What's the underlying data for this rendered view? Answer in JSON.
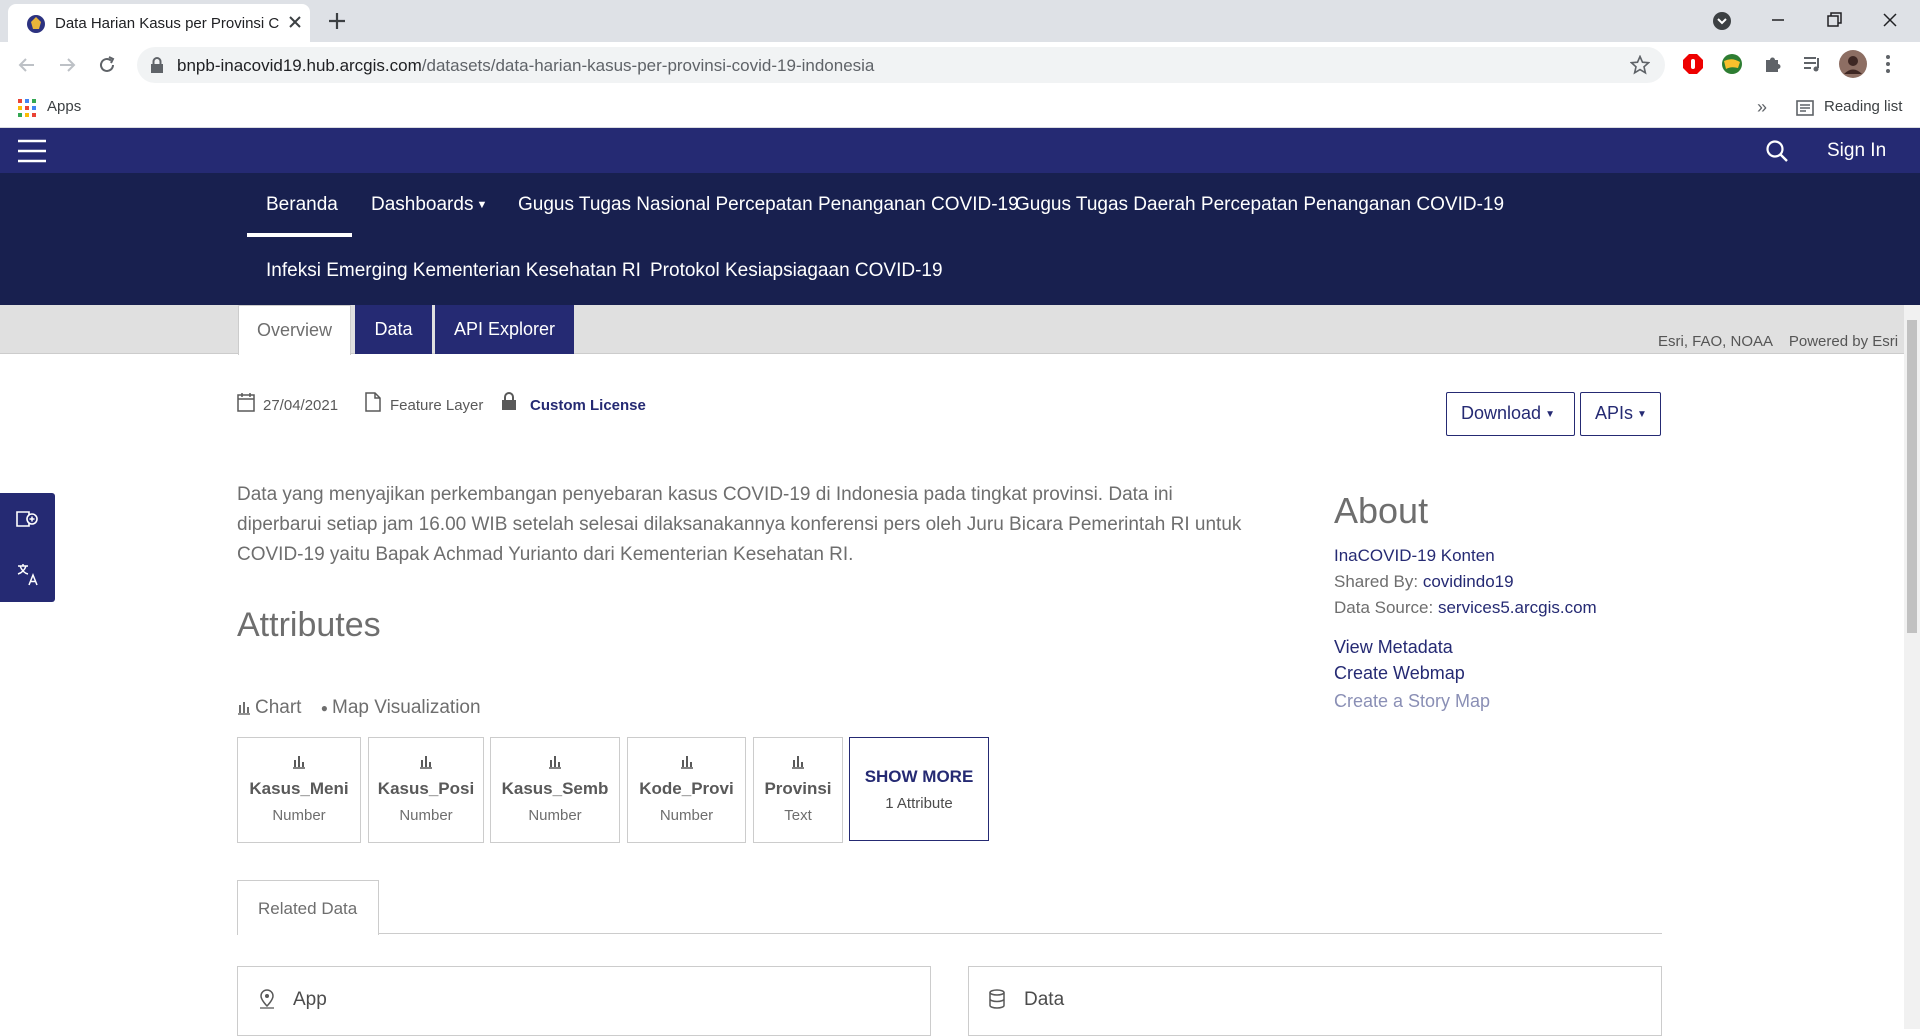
{
  "browser": {
    "tab_title": "Data Harian Kasus per Provinsi C",
    "url_host": "bnpb-inacovid19.hub.arcgis.com",
    "url_path": "/datasets/data-harian-kasus-per-provinsi-covid-19-indonesia",
    "bookmarks": {
      "apps": "Apps",
      "reading_list": "Reading list"
    }
  },
  "site": {
    "sign_in": "Sign In",
    "nav": [
      {
        "label": "Beranda"
      },
      {
        "label": "Dashboards"
      },
      {
        "label": "Gugus Tugas Nasional Percepatan Penanganan COVID-19"
      },
      {
        "label": "Gugus Tugas Daerah Percepatan Penanganan COVID-19"
      },
      {
        "label": "Infeksi Emerging Kementerian Kesehatan RI"
      },
      {
        "label": "Protokol Kesiapsiagaan COVID-19"
      }
    ]
  },
  "tabs": {
    "overview": "Overview",
    "data": "Data",
    "api": "API Explorer"
  },
  "attribution": "Esri, FAO, NOAA    Powered by Esri",
  "meta": {
    "date": "27/04/2021",
    "type": "Feature Layer",
    "license": "Custom License"
  },
  "buttons": {
    "download": "Download",
    "apis": "APIs"
  },
  "description": "Data yang menyajikan perkembangan penyebaran kasus COVID-19 di Indonesia pada tingkat provinsi. Data ini diperbarui setiap jam 16.00 WIB setelah selesai dilaksanakannya konferensi pers oleh Juru Bicara Pemerintah RI untuk COVID-19 yaitu Bapak Achmad Yurianto dari Kementerian Kesehatan RI.",
  "attributes": {
    "title": "Attributes",
    "view_chart": "Chart",
    "view_map": "Map Visualization",
    "cards": [
      {
        "name": "Kasus_Meni",
        "type": "Number"
      },
      {
        "name": "Kasus_Posi",
        "type": "Number"
      },
      {
        "name": "Kasus_Semb",
        "type": "Number"
      },
      {
        "name": "Kode_Provi",
        "type": "Number"
      },
      {
        "name": "Provinsi",
        "type": "Text"
      }
    ],
    "show_more": "SHOW MORE",
    "show_more_sub": "1 Attribute"
  },
  "about": {
    "title": "About",
    "owner": "InaCOVID-19 Konten",
    "shared_by_label": "Shared By:",
    "shared_by": "covidindo19",
    "source_label": "Data Source:",
    "source": "services5.arcgis.com",
    "view_metadata": "View Metadata",
    "create_webmap": "Create Webmap",
    "create_story": "Create a Story Map"
  },
  "related": {
    "tab": "Related Data",
    "app": "App",
    "data": "Data"
  },
  "colors": {
    "brand": "#252a73",
    "nav_bg": "#18204f"
  }
}
